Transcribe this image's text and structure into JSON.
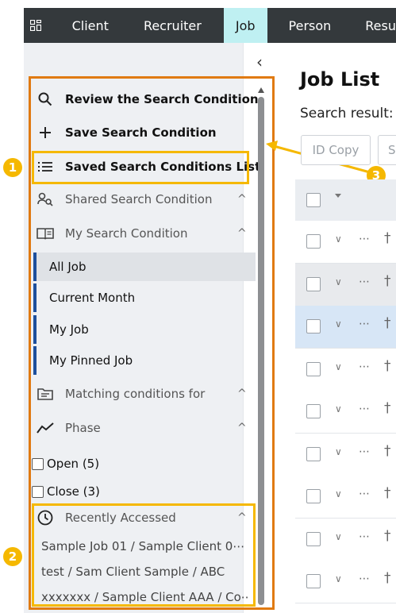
{
  "topnav": {
    "grid_icon": "grid-icon",
    "tabs": [
      {
        "label": "Client"
      },
      {
        "label": "Recruiter"
      },
      {
        "label": "Job",
        "active": true
      },
      {
        "label": "Person"
      },
      {
        "label": "Resu"
      }
    ]
  },
  "sidebar": {
    "actions": [
      {
        "label": "Review the Search Condition",
        "icon": "search-icon"
      },
      {
        "label": "Save Search Condition",
        "icon": "plus-icon"
      },
      {
        "label": "Saved Search Conditions List",
        "icon": "list-icon"
      }
    ],
    "groups": {
      "shared": {
        "label": "Shared Search Condition",
        "icon": "user-search-icon"
      },
      "my": {
        "label": "My Search Condition",
        "icon": "book-icon"
      },
      "matching": {
        "label": "Matching conditions for",
        "icon": "folder-icon"
      },
      "phase": {
        "label": "Phase",
        "icon": "trend-icon"
      },
      "recent": {
        "label": "Recently Accessed",
        "icon": "clock-icon"
      }
    },
    "conditions": [
      {
        "label": "All Job",
        "active": true
      },
      {
        "label": "Current Month"
      },
      {
        "label": "My Job"
      },
      {
        "label": "My Pinned Job"
      }
    ],
    "phase_options": [
      {
        "label": "Open (5)"
      },
      {
        "label": "Close (3)"
      }
    ],
    "recent_items": [
      {
        "label": "Sample Job 01 / Sample Client 0⋯"
      },
      {
        "label": "test / Sam Client Sample / ABC"
      },
      {
        "label": "xxxxxxx / Sample Client AAA / Co⋯"
      }
    ]
  },
  "main": {
    "title": "Job List",
    "result_label": "Search result:",
    "buttons": {
      "id_copy": "ID Copy",
      "second": "S"
    },
    "table_rows": [
      {
        "state": "normal"
      },
      {
        "state": "grey"
      },
      {
        "state": "blue"
      },
      {
        "state": "normal"
      },
      {
        "state": "normal"
      },
      {
        "state": "normal"
      },
      {
        "state": "normal"
      },
      {
        "state": "normal"
      },
      {
        "state": "normal"
      }
    ]
  },
  "callouts": {
    "badge_1": "1",
    "badge_2": "2",
    "badge_3": "3"
  },
  "colors": {
    "nav_bg": "#34393c",
    "nav_active": "#bff0f2",
    "callout_orange": "#e07a12",
    "callout_yellow": "#f5b800",
    "condition_accent": "#1e4f9c"
  }
}
